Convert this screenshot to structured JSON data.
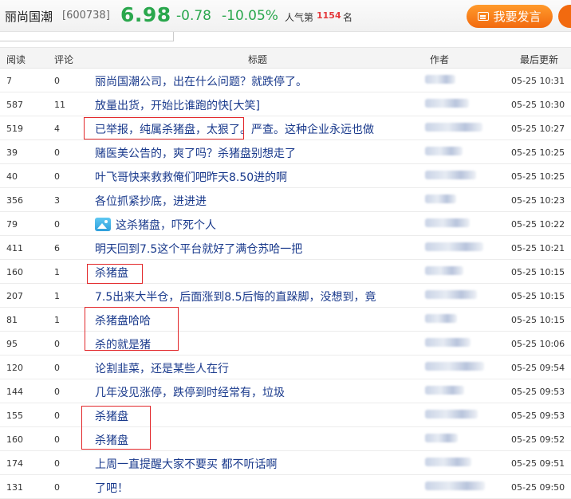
{
  "header": {
    "stock_name": "丽尚国潮",
    "stock_code": "[600738]",
    "price": "6.98",
    "change": "-0.78",
    "change_pct": "-10.05%",
    "popularity_label": "人气第",
    "popularity_rank": "1154",
    "popularity_unit": "名",
    "post_button": "我要发言"
  },
  "table": {
    "columns": {
      "read": "阅读",
      "comment": "评论",
      "title": "标题",
      "author": "作者",
      "updated": "最后更新"
    },
    "rows": [
      {
        "read": "7",
        "comment": "0",
        "title": "丽尚国潮公司，出在什么问题？就跌停了。",
        "time": "05-25 10:31"
      },
      {
        "read": "587",
        "comment": "11",
        "title": "放量出货，开始比谁跑的快[大笑]",
        "time": "05-25 10:30"
      },
      {
        "read": "519",
        "comment": "4",
        "title": "已举报，纯属杀猪盘，太狠了。严查。这种企业永远也做",
        "time": "05-25 10:27"
      },
      {
        "read": "39",
        "comment": "0",
        "title": "赌医美公告的，爽了吗？杀猪盘别想走了",
        "time": "05-25 10:25"
      },
      {
        "read": "40",
        "comment": "0",
        "title": "叶飞哥快来救救俺们吧昨天8.50进的啊",
        "time": "05-25 10:25"
      },
      {
        "read": "356",
        "comment": "3",
        "title": "各位抓紧抄底，进进进",
        "time": "05-25 10:23"
      },
      {
        "read": "79",
        "comment": "0",
        "title": "这杀猪盘，吓死个人",
        "time": "05-25 10:22",
        "has_image": true
      },
      {
        "read": "411",
        "comment": "6",
        "title": "明天回到7.5这个平台就好了满仓苏哈一把",
        "time": "05-25 10:21"
      },
      {
        "read": "160",
        "comment": "1",
        "title": "杀猪盘",
        "time": "05-25 10:15"
      },
      {
        "read": "207",
        "comment": "1",
        "title": "7.5出来大半仓，后面涨到8.5后悔的直跺脚，没想到，竟",
        "time": "05-25 10:15"
      },
      {
        "read": "81",
        "comment": "1",
        "title": "杀猪盘哈哈",
        "time": "05-25 10:15"
      },
      {
        "read": "95",
        "comment": "0",
        "title": "杀的就是猪",
        "time": "05-25 10:06"
      },
      {
        "read": "120",
        "comment": "0",
        "title": "论割韭菜，还是某些人在行",
        "time": "05-25 09:54"
      },
      {
        "read": "144",
        "comment": "0",
        "title": "几年没见涨停，跌停到时经常有，垃圾",
        "time": "05-25 09:53"
      },
      {
        "read": "155",
        "comment": "0",
        "title": "杀猪盘",
        "time": "05-25 09:53"
      },
      {
        "read": "160",
        "comment": "0",
        "title": "杀猪盘",
        "time": "05-25 09:52"
      },
      {
        "read": "174",
        "comment": "0",
        "title": "上周一直提醒大家不要买 都不听话啊",
        "time": "05-25 09:51"
      },
      {
        "read": "131",
        "comment": "0",
        "title": "了吧！",
        "time": "05-25 09:50"
      }
    ]
  },
  "colors": {
    "down_green": "#2aa74d",
    "link_blue": "#1a3a8c",
    "highlight_red": "#e2272a",
    "button_orange": "#f26a0f"
  }
}
